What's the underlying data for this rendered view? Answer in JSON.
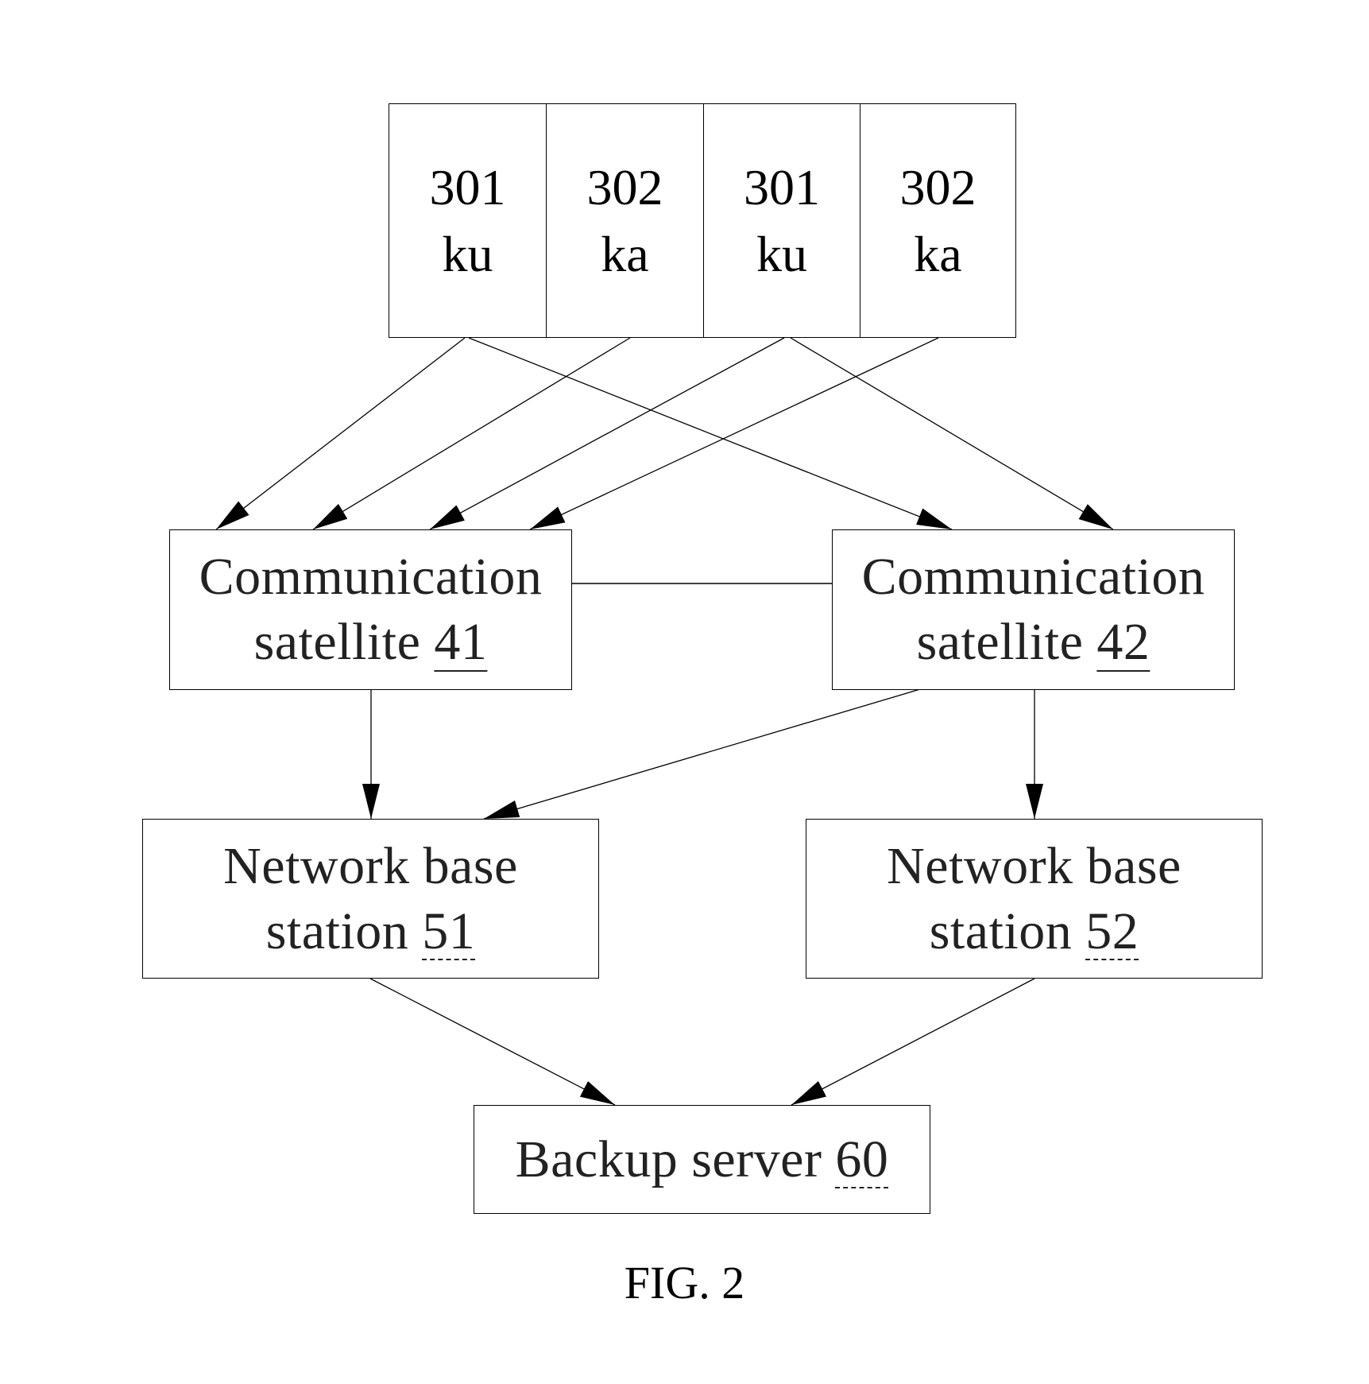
{
  "figure_caption": "FIG. 2",
  "antenna_array": {
    "cells": [
      {
        "number": "301",
        "band": "ku"
      },
      {
        "number": "302",
        "band": "ka"
      },
      {
        "number": "301",
        "band": "ku"
      },
      {
        "number": "302",
        "band": "ka"
      }
    ]
  },
  "nodes": {
    "sat41": {
      "line1": "Communication",
      "line2_text": "satellite ",
      "ref": "41"
    },
    "sat42": {
      "line1": "Communication",
      "line2_text": "satellite ",
      "ref": "42"
    },
    "nbs51": {
      "line1": "Network base",
      "line2_text": "station ",
      "ref": "51"
    },
    "nbs52": {
      "line1": "Network base",
      "line2_text": "station ",
      "ref": "52"
    },
    "backup60": {
      "line1_text": "Backup server ",
      "ref": "60"
    }
  },
  "edges": [
    {
      "from": "301-ku (1)",
      "to": "Communication satellite 41",
      "arrow": true
    },
    {
      "from": "301-ku (1)",
      "to": "Communication satellite 42",
      "arrow": true
    },
    {
      "from": "302-ka (1)",
      "to": "Communication satellite 41",
      "arrow": true
    },
    {
      "from": "301-ku (2)",
      "to": "Communication satellite 41",
      "arrow": true
    },
    {
      "from": "301-ku (2)",
      "to": "Communication satellite 42",
      "arrow": true
    },
    {
      "from": "302-ka (2)",
      "to": "Communication satellite 41",
      "arrow": true
    },
    {
      "from": "Communication satellite 41",
      "to": "Communication satellite 42",
      "arrow": false
    },
    {
      "from": "Communication satellite 41",
      "to": "Network base station 51",
      "arrow": true
    },
    {
      "from": "Communication satellite 42",
      "to": "Network base station 51",
      "arrow": true
    },
    {
      "from": "Communication satellite 42",
      "to": "Network base station 52",
      "arrow": true
    },
    {
      "from": "Network base station 51",
      "to": "Backup server 60",
      "arrow": true
    },
    {
      "from": "Network base station 52",
      "to": "Backup server 60",
      "arrow": true
    }
  ]
}
